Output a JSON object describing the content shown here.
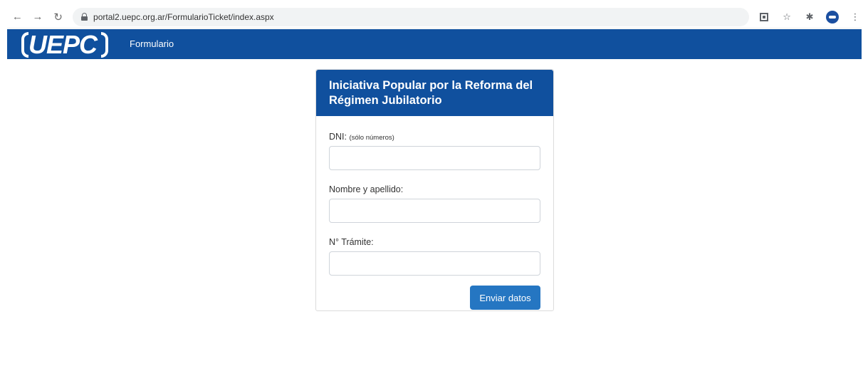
{
  "browser": {
    "url": "portal2.uepc.org.ar/FormularioTicket/index.aspx",
    "back_icon": "back-arrow-icon",
    "forward_icon": "forward-arrow-icon",
    "reload_icon": "reload-icon"
  },
  "navbar": {
    "logo": "UEPC",
    "link": "Formulario",
    "color": "#10509e"
  },
  "form": {
    "title": "Iniciativa Popular por la Reforma del Régimen Jubilatorio",
    "dni_label": "DNI:",
    "dni_hint": "(sólo números)",
    "dni_value": "",
    "name_label": "Nombre y apellido:",
    "name_value": "",
    "tramite_label": "N° Trámite:",
    "tramite_value": "",
    "submit_label": "Enviar datos"
  }
}
